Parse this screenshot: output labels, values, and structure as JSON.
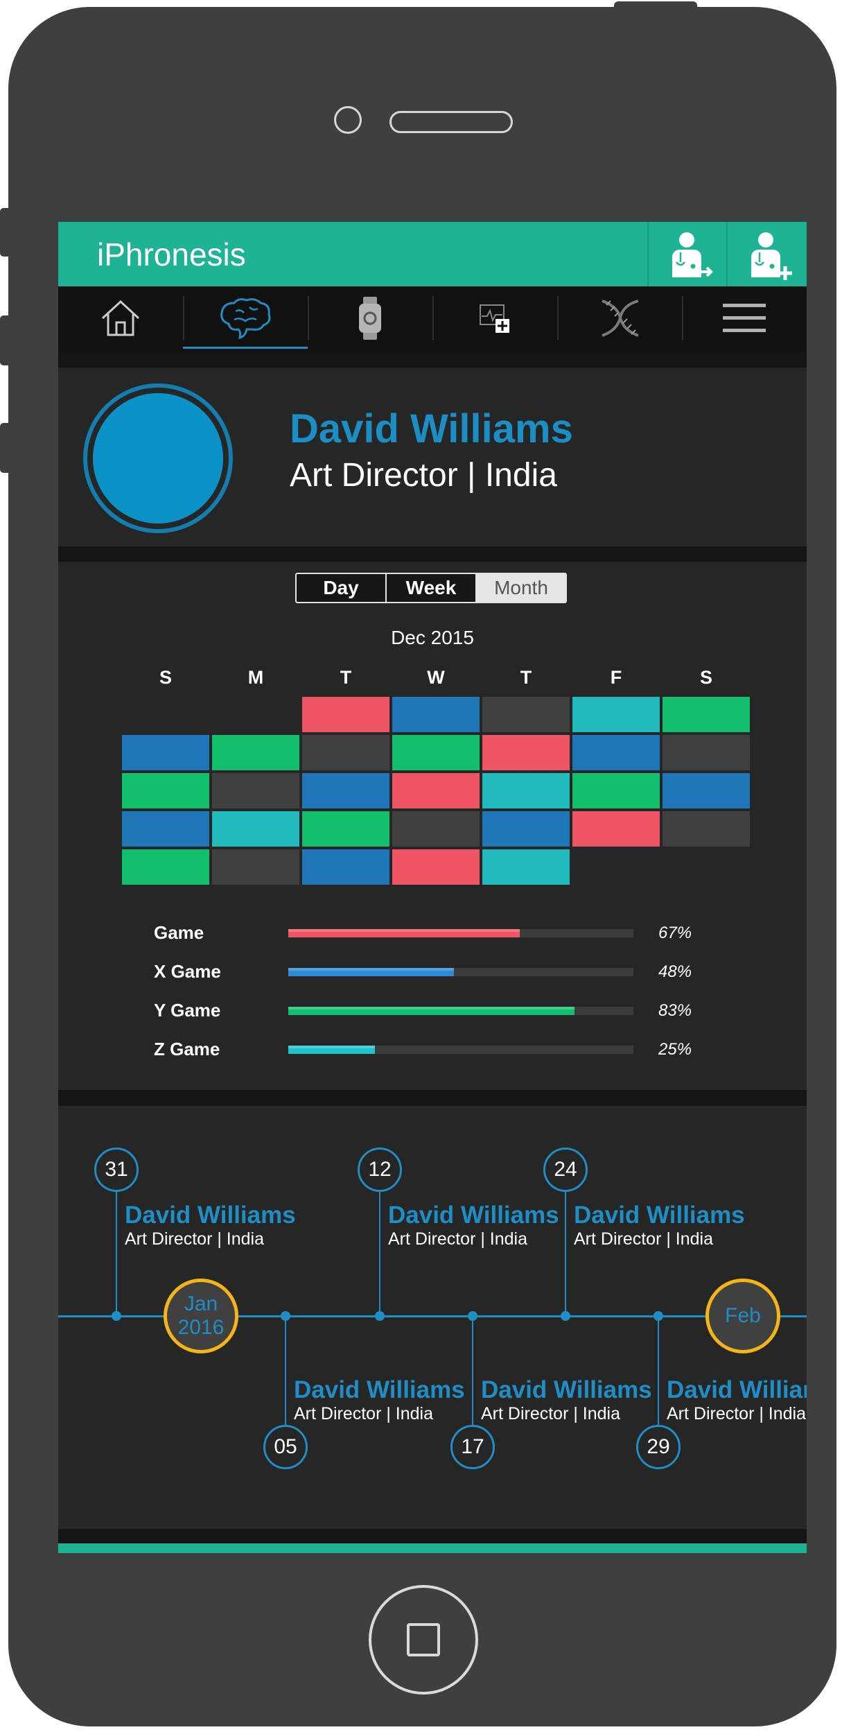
{
  "app": {
    "title": "iPhronesis"
  },
  "nav": {
    "items": [
      {
        "icon": "home-icon",
        "active": false
      },
      {
        "icon": "brain-icon",
        "active": true
      },
      {
        "icon": "smartwatch-icon",
        "active": false
      },
      {
        "icon": "health-monitor-icon",
        "active": false
      },
      {
        "icon": "dna-icon",
        "active": false
      },
      {
        "icon": "menu-icon",
        "active": false
      }
    ]
  },
  "header_actions": [
    {
      "icon": "doctor-share-icon"
    },
    {
      "icon": "doctor-add-icon"
    }
  ],
  "profile": {
    "name": "David Williams",
    "role": "Art Director | India"
  },
  "period_toggle": {
    "options": [
      "Day",
      "Week",
      "Month"
    ],
    "selected": "Month"
  },
  "calendar": {
    "month_label": "Dec 2015",
    "weekdays": [
      "S",
      "M",
      "T",
      "W",
      "T",
      "F",
      "S"
    ],
    "colors": {
      "red": "#ee5565",
      "blue": "#1f76b8",
      "green": "#13bf6d",
      "teal": "#22bbbd",
      "gray": "#404040"
    },
    "weeks": [
      [
        null,
        null,
        "red",
        "blue",
        "gray",
        "teal",
        "green"
      ],
      [
        "blue",
        "green",
        "gray",
        "green",
        "red",
        "blue",
        "gray"
      ],
      [
        "green",
        "gray",
        "blue",
        "red",
        "teal",
        "green",
        "blue"
      ],
      [
        "blue",
        "teal",
        "green",
        "gray",
        "blue",
        "red",
        "gray"
      ],
      [
        "green",
        "gray",
        "blue",
        "red",
        "teal",
        null,
        null
      ]
    ]
  },
  "progress": [
    {
      "label": "Game",
      "value": "67%",
      "fraction": 0.67,
      "color": "#ee5565"
    },
    {
      "label": "X Game",
      "value": "48%",
      "fraction": 0.48,
      "color": "#2b8bd6"
    },
    {
      "label": "Y Game",
      "value": "83%",
      "fraction": 0.83,
      "color": "#13bf6d"
    },
    {
      "label": "Z Game",
      "value": "25%",
      "fraction": 0.25,
      "color": "#22c3cf"
    }
  ],
  "timeline": {
    "events": [
      {
        "day": "31",
        "name": "David Williams",
        "role": "Art Director | India"
      },
      {
        "day": "05",
        "name": "David Williams",
        "role": "Art Director | India"
      },
      {
        "day": "12",
        "name": "David Williams",
        "role": "Art Director | India"
      },
      {
        "day": "17",
        "name": "David Williams",
        "role": "Art Director | India"
      },
      {
        "day": "24",
        "name": "David Williams",
        "role": "Art Director | India"
      },
      {
        "day": "29",
        "name": "David Williams",
        "role": "Art Director | India"
      }
    ],
    "months": [
      {
        "line1": "Jan",
        "line2": "2016"
      },
      {
        "line1": "Feb",
        "line2": ""
      }
    ]
  }
}
